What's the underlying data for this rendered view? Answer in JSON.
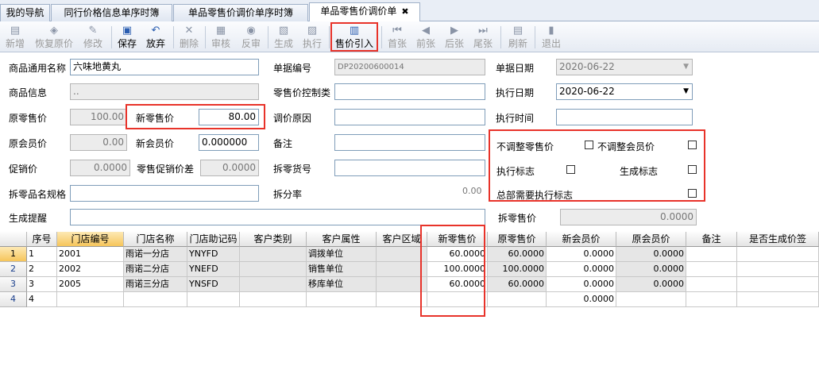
{
  "tabs": [
    {
      "label": "我的导航"
    },
    {
      "label": "同行价格信息单序时簿"
    },
    {
      "label": "单品零售价调价单序时簿"
    },
    {
      "label": "单品零售价调价单",
      "close": "✖"
    }
  ],
  "toolbar": {
    "new": "新增",
    "restore_price": "恢复原价",
    "edit": "修改",
    "save": "保存",
    "discard": "放弃",
    "delete": "删除",
    "review": "审核",
    "unreview": "反审",
    "generate": "生成",
    "execute": "执行",
    "price_import": "售价引入",
    "first": "首张",
    "prev": "前张",
    "next": "后张",
    "last": "尾张",
    "refresh": "刷新",
    "exit": "退出"
  },
  "form": {
    "product_name_label": "商品通用名称",
    "product_name": "六味地黄丸",
    "doc_no_label": "单据编号",
    "doc_no": "DP20200600014",
    "doc_date_label": "单据日期",
    "doc_date": "2020-06-22",
    "product_info_label": "商品信息",
    "product_info": "..",
    "retail_ctrl_label": "零售价控制类",
    "retail_ctrl": "",
    "exec_date_label": "执行日期",
    "exec_date": "2020-06-22",
    "orig_retail_label": "原零售价",
    "orig_retail": "100.00",
    "new_retail_label": "新零售价",
    "new_retail": "80.00",
    "adjust_reason_label": "调价原因",
    "adjust_reason": "",
    "exec_time_label": "执行时间",
    "exec_time": "",
    "orig_member_label": "原会员价",
    "orig_member": "0.00",
    "new_member_label": "新会员价",
    "new_member": "0.000000",
    "remark_label": "备注",
    "remark": "",
    "promo_label": "促销价",
    "promo": "0.0000",
    "new_promo_diff_label": "零售促销价差",
    "new_promo_diff": "0.0000",
    "split_no_label": "拆零货号",
    "split_no": "",
    "split_spec_label": "拆零品名规格",
    "split_spec": "",
    "split_rate_label": "拆分率",
    "split_rate": "0.00",
    "gen_remind_label": "生成提醒",
    "gen_remind": "",
    "split_retail_label": "拆零售价",
    "split_retail": "0.0000",
    "no_adj_retail_label": "不调整零售价",
    "no_adj_member_label": "不调整会员价",
    "exec_flag_label": "执行标志",
    "gen_flag_label": "生成标志",
    "hq_exec_label": "总部需要执行标志"
  },
  "grid": {
    "columns": [
      "序号",
      "门店编号",
      "门店名称",
      "门店助记码",
      "客户类别",
      "客户属性",
      "客户区域",
      "新零售价",
      "原零售价",
      "新会员价",
      "原会员价",
      "备注",
      "是否生成价签"
    ],
    "rows": [
      {
        "rn": "1",
        "seq": "1",
        "code": "2001",
        "name": "雨诺一分店",
        "mnem": "YNYFD",
        "cat": "",
        "attr": "调拨单位",
        "area": "",
        "new_retail": "60.0000",
        "orig_retail": "60.0000",
        "new_member": "0.0000",
        "orig_member": "0.0000",
        "remark": "",
        "tag": ""
      },
      {
        "rn": "2",
        "seq": "2",
        "code": "2002",
        "name": "雨诺二分店",
        "mnem": "YNEFD",
        "cat": "",
        "attr": "销售单位",
        "area": "",
        "new_retail": "100.0000",
        "orig_retail": "100.0000",
        "new_member": "0.0000",
        "orig_member": "0.0000",
        "remark": "",
        "tag": ""
      },
      {
        "rn": "3",
        "seq": "3",
        "code": "2005",
        "name": "雨诺三分店",
        "mnem": "YNSFD",
        "cat": "",
        "attr": "移库单位",
        "area": "",
        "new_retail": "60.0000",
        "orig_retail": "60.0000",
        "new_member": "0.0000",
        "orig_member": "0.0000",
        "remark": "",
        "tag": ""
      },
      {
        "rn": "4",
        "seq": "4",
        "code": "",
        "name": "",
        "mnem": "",
        "cat": "",
        "attr": "",
        "area": "",
        "new_retail": "",
        "orig_retail": "",
        "new_member": "0.0000",
        "orig_member": "",
        "remark": "",
        "tag": ""
      }
    ]
  },
  "colors": {
    "highlight": "#e8332a",
    "accent": "#2a5db0",
    "header_selected": "#f6c55a"
  }
}
